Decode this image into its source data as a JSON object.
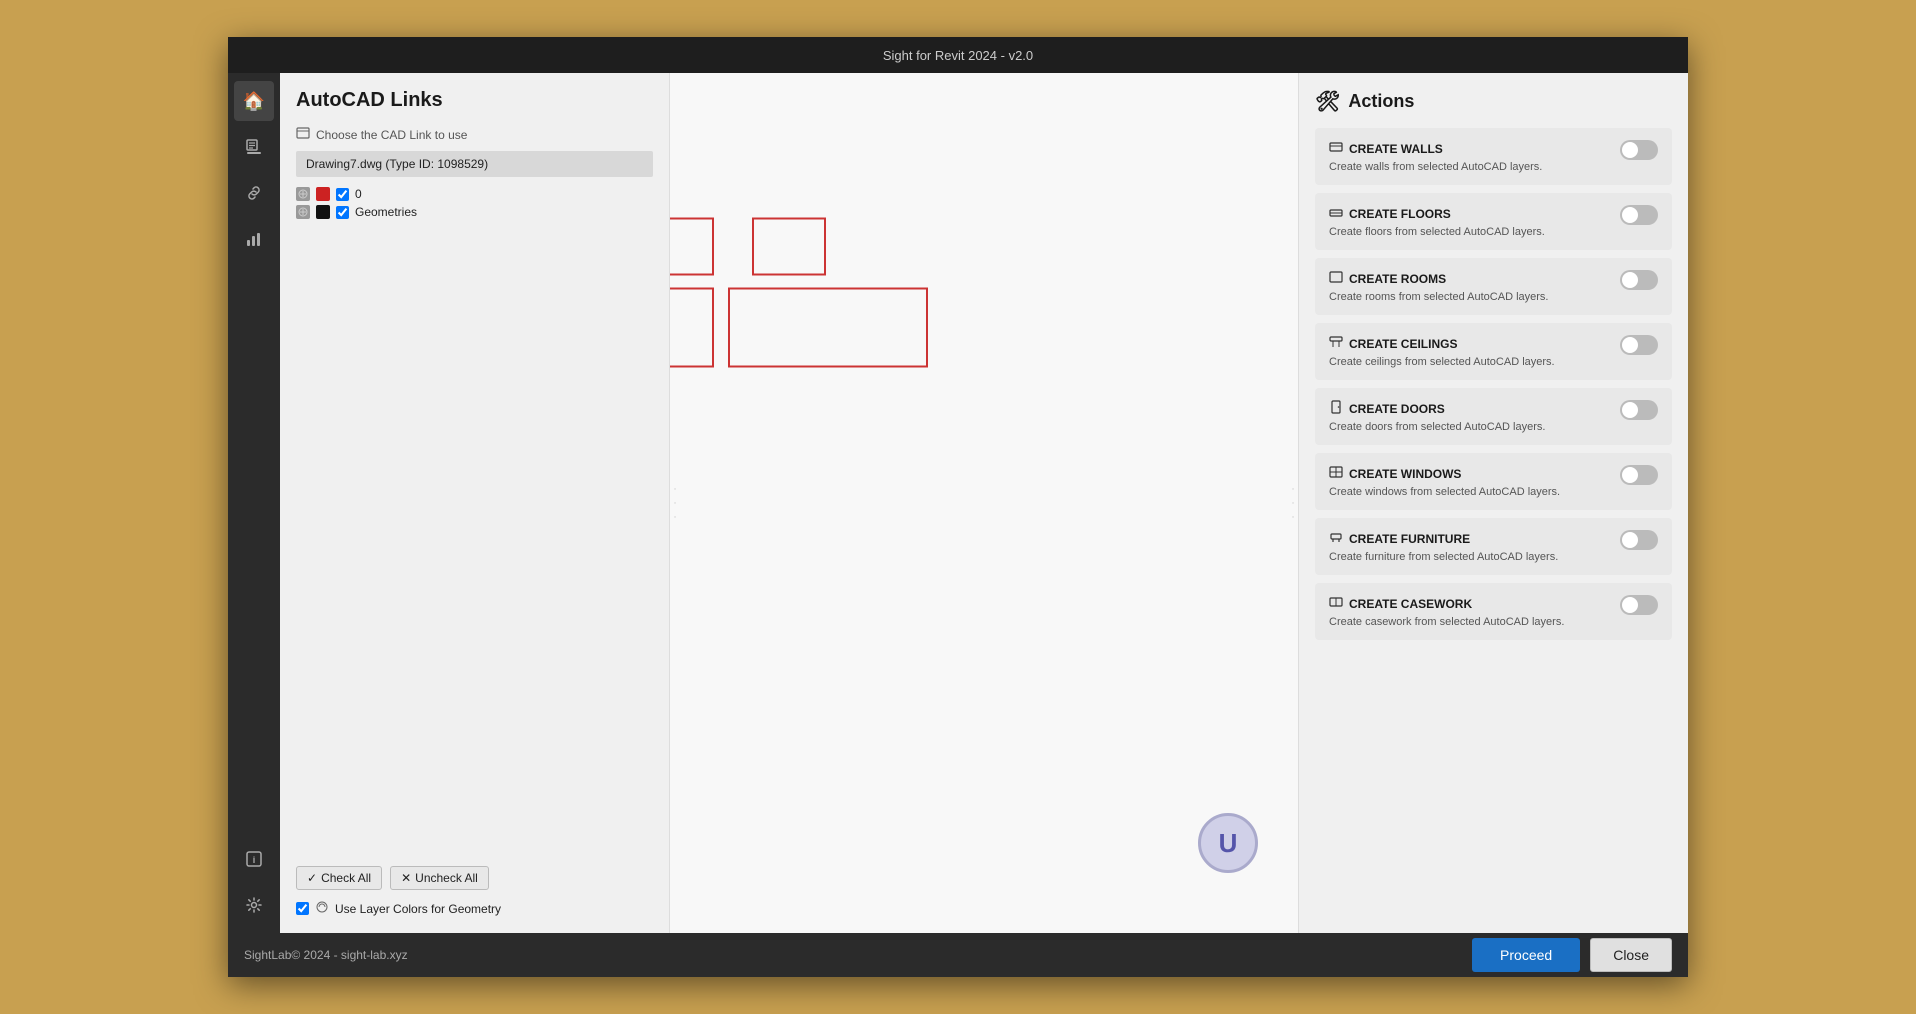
{
  "window": {
    "title": "Sight for Revit 2024 - v2.0"
  },
  "sidebar": {
    "items": [
      {
        "id": "home",
        "icon": "🏠",
        "active": true
      },
      {
        "id": "edit",
        "icon": "✏️",
        "active": false
      },
      {
        "id": "link",
        "icon": "🔗",
        "active": false
      },
      {
        "id": "chart",
        "icon": "📊",
        "active": false
      },
      {
        "id": "info",
        "icon": "ℹ️",
        "active": false
      },
      {
        "id": "settings",
        "icon": "⚙️",
        "active": false
      }
    ]
  },
  "left_panel": {
    "title": "AutoCAD Links",
    "hint": "Choose the CAD Link to use",
    "link_item": "Drawing7.dwg (Type ID: 1098529)",
    "layers": [
      {
        "id": "layer0",
        "color": "#cc2222",
        "checked": true,
        "label": "0"
      },
      {
        "id": "layer_geom",
        "color": "#111111",
        "checked": true,
        "label": "Geometries"
      }
    ],
    "check_all_label": "Check All",
    "uncheck_all_label": "Uncheck All",
    "use_layer_colors_label": "Use Layer Colors for Geometry",
    "use_layer_colors_checked": true
  },
  "actions": {
    "title": "Actions",
    "icon": "🛠",
    "items": [
      {
        "id": "create-walls",
        "icon": "🧱",
        "title": "CREATE WALLS",
        "desc": "Create walls from selected AutoCAD layers.",
        "enabled": false
      },
      {
        "id": "create-floors",
        "icon": "🏗",
        "title": "CREATE FLOORS",
        "desc": "Create floors from selected AutoCAD layers.",
        "enabled": false
      },
      {
        "id": "create-rooms",
        "icon": "🏠",
        "title": "CREATE ROOMS",
        "desc": "Create rooms from selected AutoCAD layers.",
        "enabled": false
      },
      {
        "id": "create-ceilings",
        "icon": "🏚",
        "title": "CREATE CEILINGS",
        "desc": "Create ceilings from selected AutoCAD layers.",
        "enabled": false
      },
      {
        "id": "create-doors",
        "icon": "🚪",
        "title": "CREATE DOORS",
        "desc": "Create doors from selected AutoCAD layers.",
        "enabled": false
      },
      {
        "id": "create-windows",
        "icon": "🪟",
        "title": "CREATE WINDOWS",
        "desc": "Create windows from selected AutoCAD layers.",
        "enabled": false
      },
      {
        "id": "create-furniture",
        "icon": "🪑",
        "title": "CREATE FURNITURE",
        "desc": "Create furniture from selected AutoCAD layers.",
        "enabled": false
      },
      {
        "id": "create-casework",
        "icon": "🗄",
        "title": "CREATE CASEWORK",
        "desc": "Create casework from selected AutoCAD layers.",
        "enabled": false
      }
    ]
  },
  "bottom_bar": {
    "copyright": "SightLab© 2024 - sight-lab.xyz",
    "proceed_label": "Proceed",
    "close_label": "Close"
  },
  "user_avatar": {
    "letter": "U"
  }
}
